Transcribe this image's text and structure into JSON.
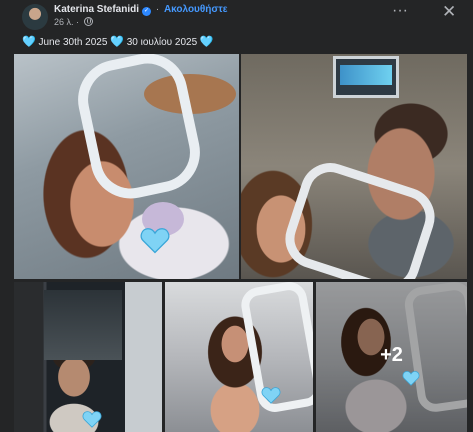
{
  "post": {
    "author": "Katerina Stefanidi",
    "follow_label": "Ακολουθήστε",
    "separator": "·",
    "time": "26 λ.",
    "meta_separator": "·",
    "more_glyph": "···",
    "close_glyph": "✕",
    "caption": {
      "heart": "🩵",
      "date_en": " June 30th 2025 ",
      "date_gr": " 30 ιουλίου 2025 "
    }
  },
  "gallery": {
    "extra_count": "+2"
  },
  "colors": {
    "background": "#242526",
    "follow_link": "#4599ff",
    "verified_badge": "#2d88ff",
    "heart": "#6ec8ef"
  },
  "icons": [
    "verified-badge-icon",
    "globe-icon",
    "more-icon",
    "close-icon",
    "heart-icon"
  ]
}
